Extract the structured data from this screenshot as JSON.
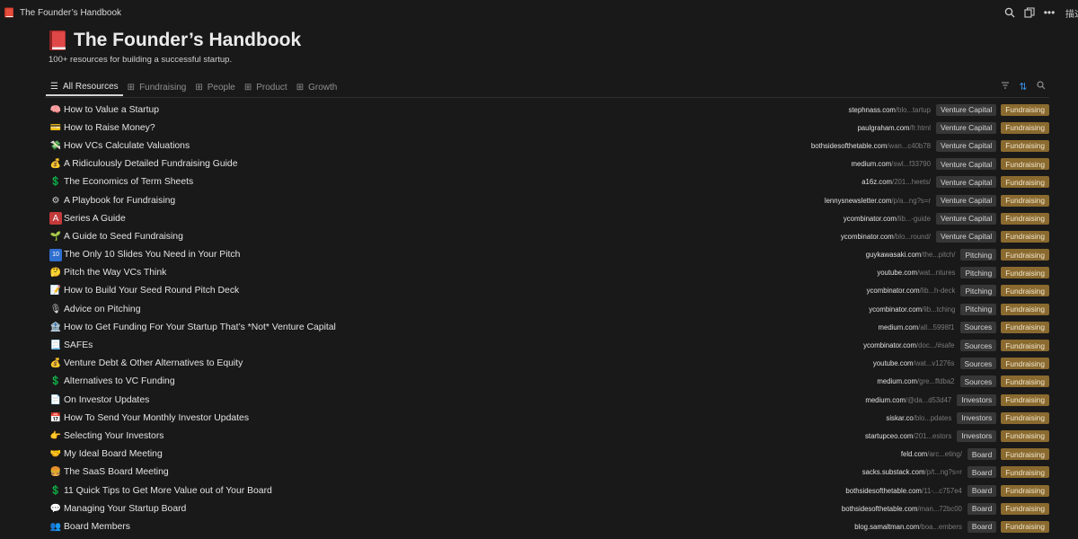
{
  "window": {
    "title": "The Founder’s Handbook",
    "clipped_text": "描述"
  },
  "header": {
    "title": "The Founder’s Handbook",
    "subtitle": "100+ resources for building a successful startup."
  },
  "tabs": [
    {
      "label": "All Resources",
      "icon": "list-icon"
    },
    {
      "label": "Fundraising",
      "icon": "gallery-icon"
    },
    {
      "label": "People",
      "icon": "gallery-icon"
    },
    {
      "label": "Product",
      "icon": "gallery-icon"
    },
    {
      "label": "Growth",
      "icon": "gallery-icon"
    }
  ],
  "colors": {
    "accent": "#3b8ee0",
    "fundraising_tag": "#8a6a2f",
    "category_tag": "#373737"
  },
  "rows": [
    {
      "emoji": "🧠",
      "emoji_name": "brain-icon",
      "name": "How to Value a Startup",
      "domain": "stephnass.com",
      "path": "/blo...tartup",
      "category": "Venture Capital",
      "tag": "Fundraising"
    },
    {
      "emoji": "💳",
      "emoji_name": "credit-card-icon",
      "name": "How to Raise Money?",
      "domain": "paulgraham.com",
      "path": "/fr.html",
      "category": "Venture Capital",
      "tag": "Fundraising"
    },
    {
      "emoji": "💸",
      "emoji_name": "money-wings-icon",
      "name": "How VCs Calculate Valuations",
      "domain": "bothsidesofthetable.com",
      "path": "/wan...c40b78",
      "category": "Venture Capital",
      "tag": "Fundraising"
    },
    {
      "emoji": "💰",
      "emoji_name": "money-bag-icon",
      "name": "A Ridiculously Detailed Fundraising Guide",
      "domain": "medium.com",
      "path": "/swl...f33790",
      "category": "Venture Capital",
      "tag": "Fundraising"
    },
    {
      "emoji": "💲",
      "emoji_name": "dollar-sign-icon",
      "name": "The Economics of Term Sheets",
      "domain": "a16z.com",
      "path": "/201...heets/",
      "category": "Venture Capital",
      "tag": "Fundraising"
    },
    {
      "emoji": "⚙",
      "emoji_name": "gear-icon",
      "name": "A Playbook for Fundraising",
      "domain": "lennysnewsletter.com",
      "path": "/p/a...ng?s=r",
      "category": "Venture Capital",
      "tag": "Fundraising"
    },
    {
      "emoji": "A",
      "emoji_name": "letter-a-icon",
      "name": "Series A Guide",
      "domain": "ycombinator.com",
      "path": "/lib...-guide",
      "category": "Venture Capital",
      "tag": "Fundraising"
    },
    {
      "emoji": "🌱",
      "emoji_name": "seedling-icon",
      "name": "A Guide to Seed Fundraising",
      "domain": "ycombinator.com",
      "path": "/blo...round/",
      "category": "Venture Capital",
      "tag": "Fundraising"
    },
    {
      "emoji": "10",
      "emoji_name": "keycap-ten-icon",
      "name": "The Only 10 Slides You Need in Your Pitch",
      "domain": "guykawasaki.com",
      "path": "/the...pitch/",
      "category": "Pitching",
      "tag": "Fundraising"
    },
    {
      "emoji": "🤔",
      "emoji_name": "thinking-face-icon",
      "name": "Pitch the Way VCs Think",
      "domain": "youtube.com",
      "path": "/wat...ntures",
      "category": "Pitching",
      "tag": "Fundraising"
    },
    {
      "emoji": "📝",
      "emoji_name": "memo-icon",
      "name": "How to Build Your Seed Round Pitch Deck",
      "domain": "ycombinator.com",
      "path": "/lib...h-deck",
      "category": "Pitching",
      "tag": "Fundraising"
    },
    {
      "emoji": "🎙",
      "emoji_name": "microphone-icon",
      "name": "Advice on Pitching",
      "domain": "ycombinator.com",
      "path": "/lib...tching",
      "category": "Pitching",
      "tag": "Fundraising"
    },
    {
      "emoji": "🏦",
      "emoji_name": "bank-icon",
      "name": "How to Get Funding For Your Startup That’s *Not* Venture Capital",
      "domain": "medium.com",
      "path": "/all...5998f1",
      "category": "Sources",
      "tag": "Fundraising"
    },
    {
      "emoji": "📃",
      "emoji_name": "page-icon",
      "name": "SAFEs",
      "domain": "ycombinator.com",
      "path": "/doc.../#safe",
      "category": "Sources",
      "tag": "Fundraising"
    },
    {
      "emoji": "💰",
      "emoji_name": "money-bag-icon",
      "name": "Venture Debt & Other Alternatives to Equity",
      "domain": "youtube.com",
      "path": "/wat...v1276s",
      "category": "Sources",
      "tag": "Fundraising"
    },
    {
      "emoji": "💲",
      "emoji_name": "dollar-sign-icon",
      "name": "Alternatives to VC Funding",
      "domain": "medium.com",
      "path": "/gre...ffdba2",
      "category": "Sources",
      "tag": "Fundraising"
    },
    {
      "emoji": "📄",
      "emoji_name": "document-icon",
      "name": "On Investor Updates",
      "domain": "medium.com",
      "path": "/@da...d53d47",
      "category": "Investors",
      "tag": "Fundraising"
    },
    {
      "emoji": "📅",
      "emoji_name": "calendar-icon",
      "name": "How To Send Your Monthly Investor Updates",
      "domain": "siskar.co",
      "path": "/blo...pdates",
      "category": "Investors",
      "tag": "Fundraising"
    },
    {
      "emoji": "👉",
      "emoji_name": "pointing-hand-icon",
      "name": "Selecting Your Investors",
      "domain": "startupceo.com",
      "path": "/201...estors",
      "category": "Investors",
      "tag": "Fundraising"
    },
    {
      "emoji": "🤝",
      "emoji_name": "handshake-icon",
      "name": "My Ideal Board Meeting",
      "domain": "feld.com",
      "path": "/arc...eting/",
      "category": "Board",
      "tag": "Fundraising"
    },
    {
      "emoji": "🍔",
      "emoji_name": "burger-icon",
      "name": "The SaaS Board Meeting",
      "domain": "sacks.substack.com",
      "path": "/p/t...ng?s=r",
      "category": "Board",
      "tag": "Fundraising"
    },
    {
      "emoji": "💲",
      "emoji_name": "dollar-sign-icon",
      "name": "11 Quick Tips to Get More Value out of Your Board",
      "domain": "bothsidesofthetable.com",
      "path": "/11-...c757e4",
      "category": "Board",
      "tag": "Fundraising"
    },
    {
      "emoji": "💬",
      "emoji_name": "speech-bubble-icon",
      "name": "Managing Your Startup Board",
      "domain": "bothsidesofthetable.com",
      "path": "/man...72bc00",
      "category": "Board",
      "tag": "Fundraising"
    },
    {
      "emoji": "👥",
      "emoji_name": "people-icon",
      "name": "Board Members",
      "domain": "blog.samaltman.com",
      "path": "/boa...embers",
      "category": "Board",
      "tag": "Fundraising"
    }
  ]
}
